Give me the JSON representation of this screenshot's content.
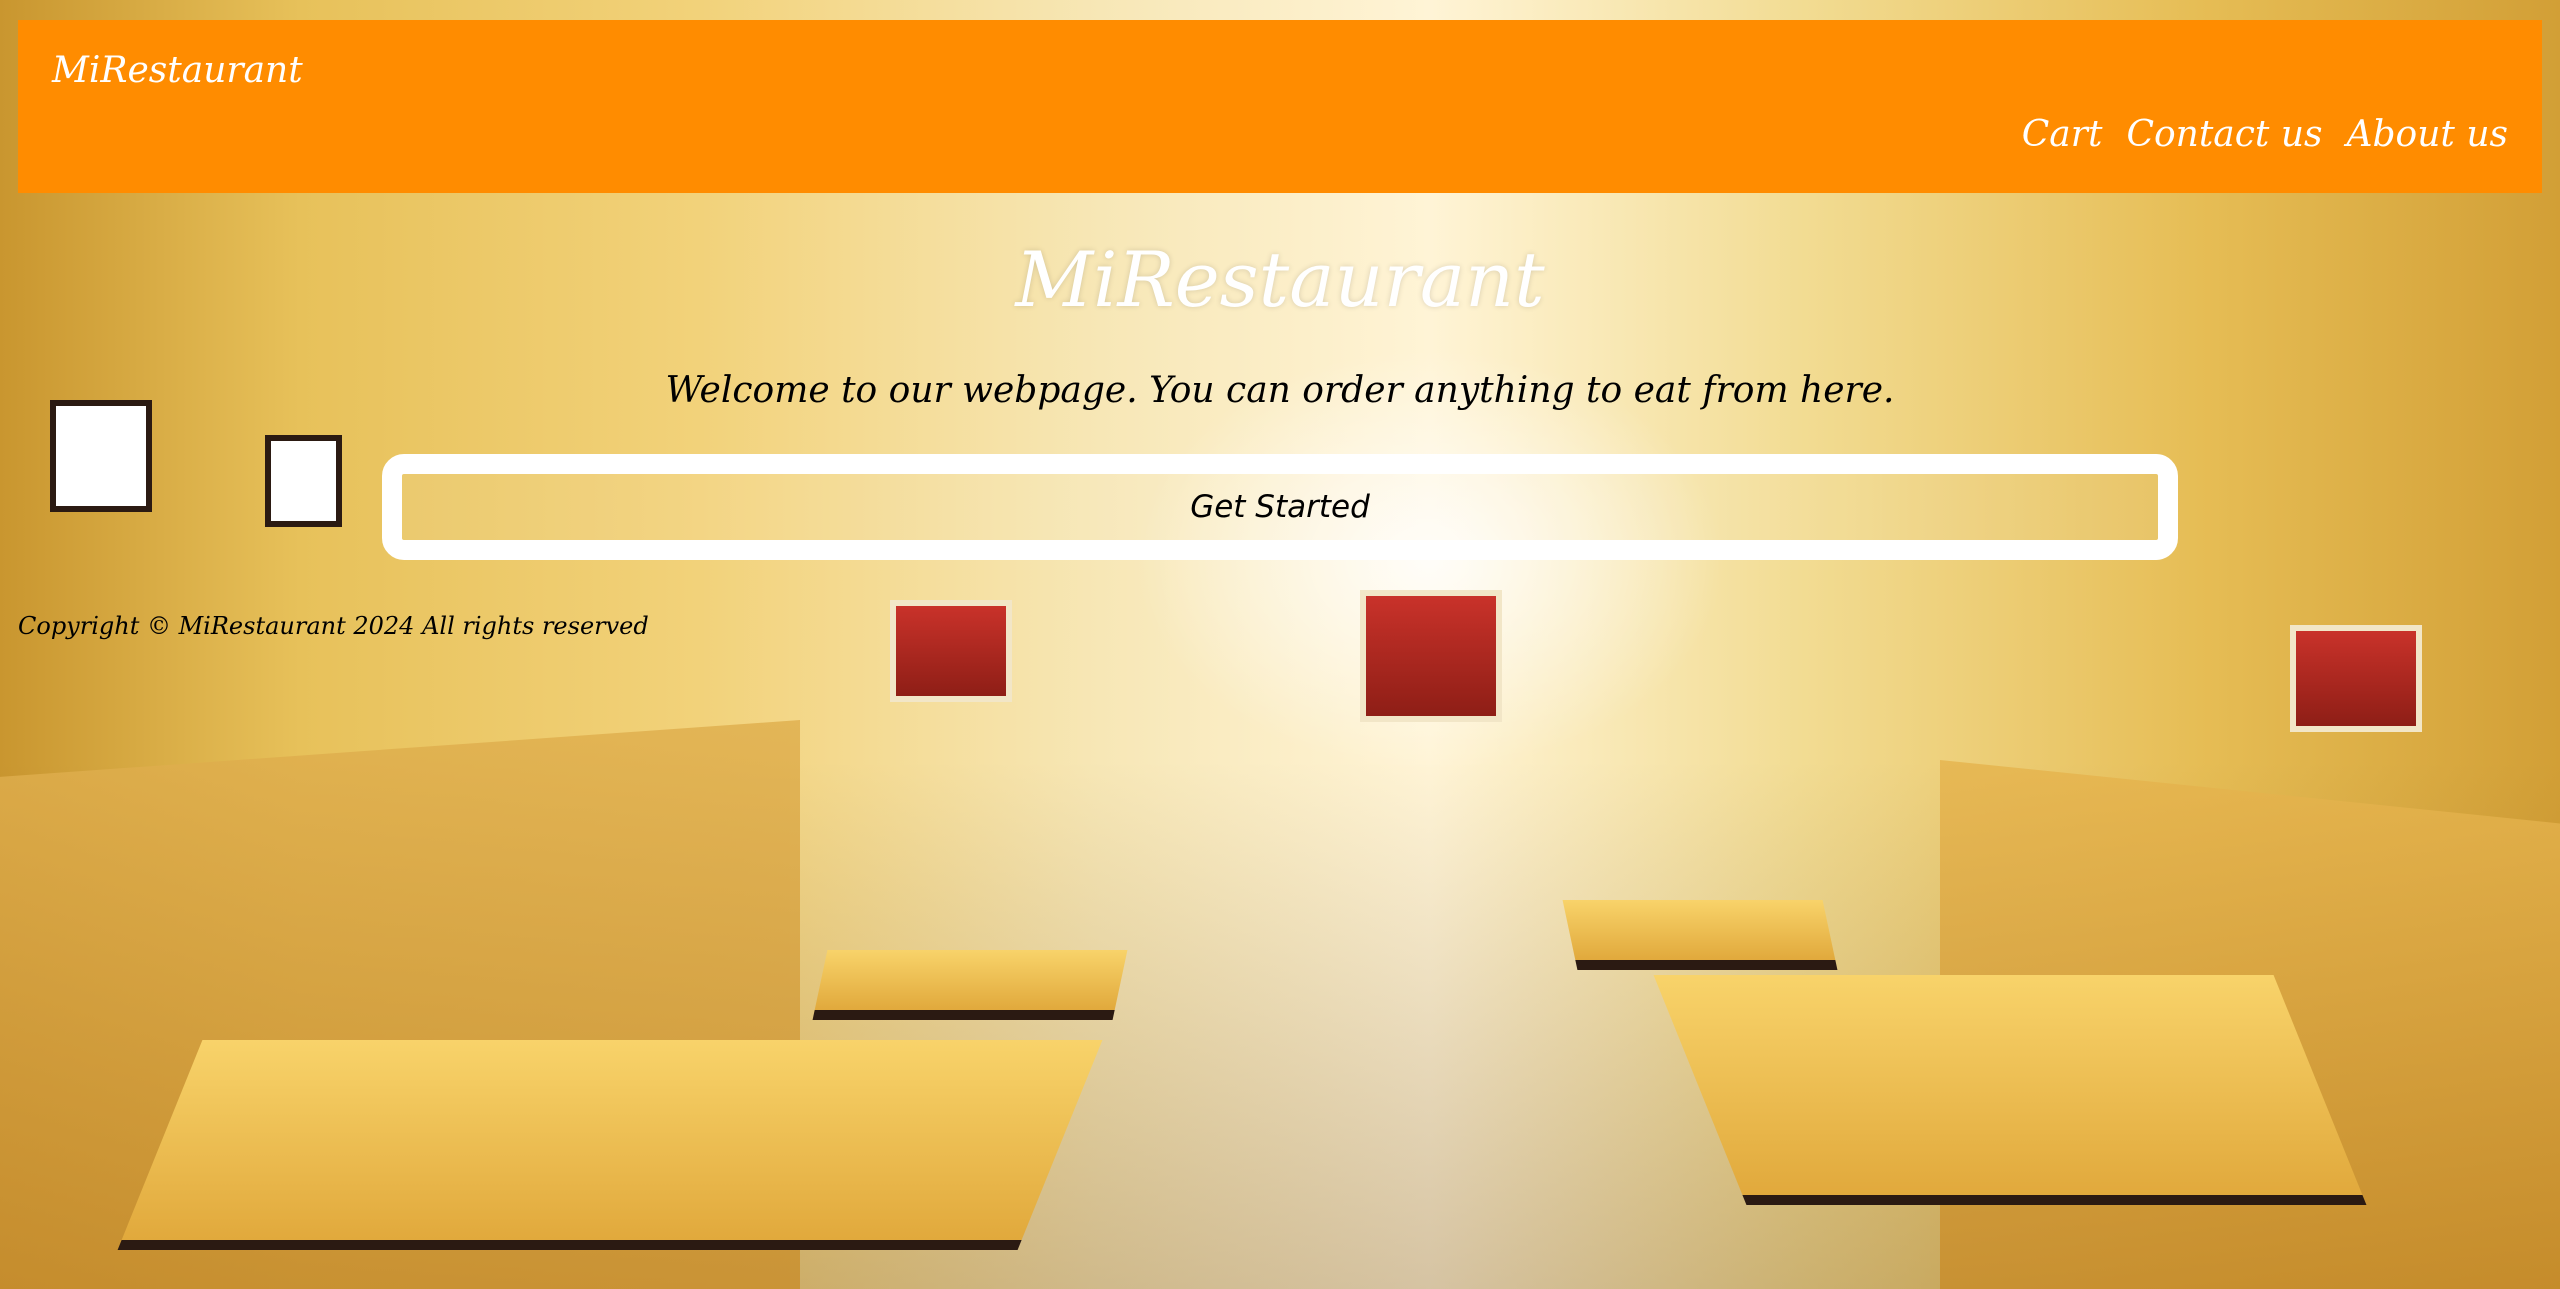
{
  "header": {
    "brand": "MiRestaurant",
    "nav": [
      {
        "label": "Cart"
      },
      {
        "label": "Contact us"
      },
      {
        "label": "About us"
      }
    ]
  },
  "hero": {
    "title": "MiRestaurant",
    "subtitle": "Welcome to our webpage. You can order anything to eat from here.",
    "cta_label": "Get Started"
  },
  "footer": {
    "copyright": "Copyright © MiRestaurant 2024 All rights reserved"
  },
  "colors": {
    "navbar_bg": "#ff8c00",
    "text_light": "#ffffff",
    "text_dark": "#000000"
  },
  "background_image": "restaurant-interior-photo"
}
